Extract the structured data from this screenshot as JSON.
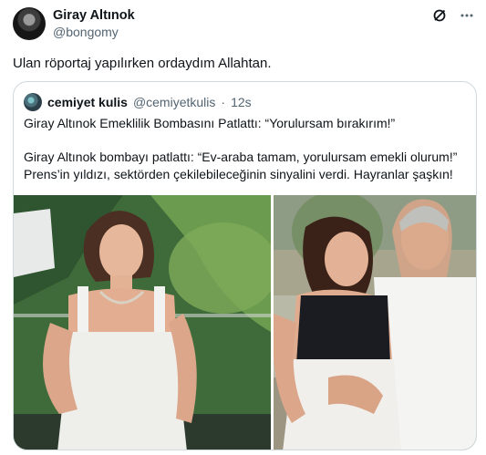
{
  "tweet": {
    "display_name": "Giray Altınok",
    "handle": "@bongomy",
    "text": "Ulan röportaj yapılırken ordaydım Allahtan."
  },
  "quoted": {
    "display_name": "cemiyet kulis",
    "handle": "@cemiyetkulis",
    "separator": "·",
    "time": "12s",
    "title": "Giray Altınok Emeklilik Bombasını Patlattı: “Yorulursam bırakırım!”",
    "body": "Giray Altınok bombayı patlattı: “Ev-araba tamam, yorulursam emekli olurum!” Prens’in yıldızı, sektörden çekilebileceğinin sinyalini verdi. Hayranlar şaşkın!"
  },
  "icons": {
    "grok": "grok-icon",
    "more": "more-icon"
  }
}
